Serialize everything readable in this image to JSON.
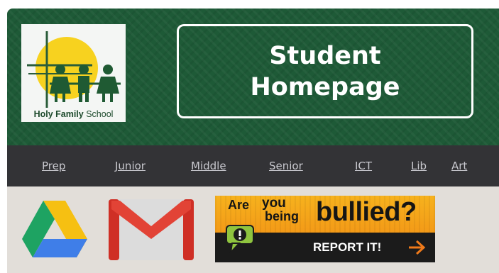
{
  "header": {
    "logo": {
      "name_bold": "Holy Family",
      "name_rest": " School"
    },
    "title_line1": "Student",
    "title_line2": "Homepage",
    "colors": {
      "header_bg": "#1e5a37",
      "title_border": "#ffffff"
    }
  },
  "nav": {
    "items": [
      {
        "label": "Prep"
      },
      {
        "label": "Junior"
      },
      {
        "label": "Middle"
      },
      {
        "label": "Senior"
      },
      {
        "label": "ICT"
      },
      {
        "label": "Lib"
      },
      {
        "label": "Art"
      }
    ],
    "colors": {
      "bg": "#333336",
      "link": "#c9c9cf"
    }
  },
  "shortcuts": {
    "drive": {
      "icon": "google-drive-icon"
    },
    "gmail": {
      "icon": "gmail-icon"
    },
    "bully_banner": {
      "are": "Are",
      "you": "you",
      "being": "being",
      "word": "bullied?",
      "report": "REPORT IT!",
      "colors": {
        "top": "#f4a31a",
        "bottom": "#1b1b1b",
        "arrow": "#ef7a1a",
        "bubble": "#8fc43f"
      }
    }
  }
}
